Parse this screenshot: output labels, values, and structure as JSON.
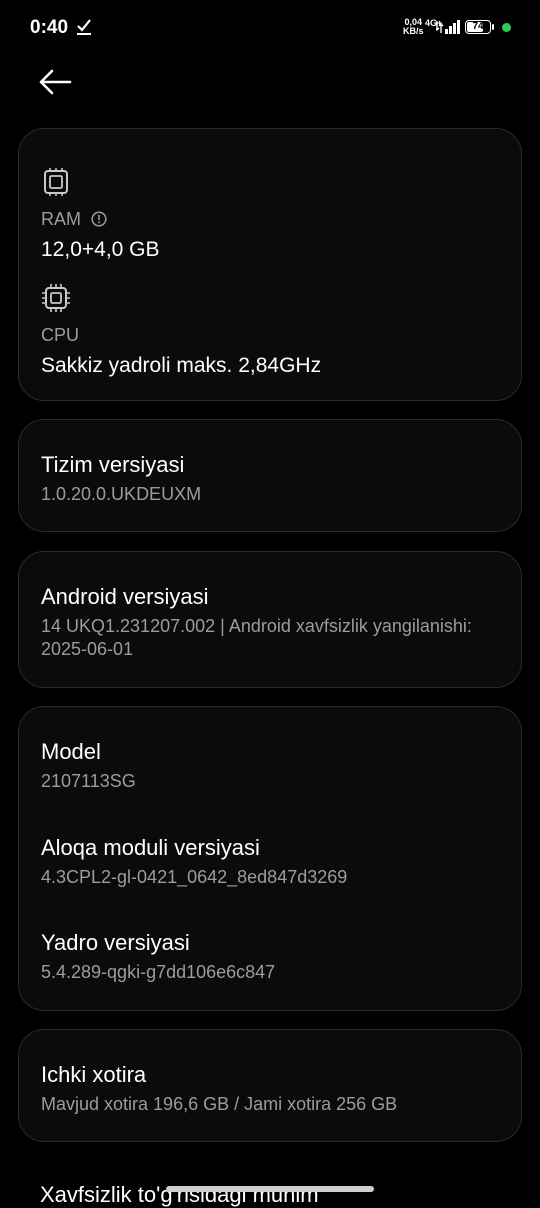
{
  "status_bar": {
    "time": "0:40",
    "net_speed_value": "0,04",
    "net_speed_unit": "KB/s",
    "network_type": "4G+",
    "battery_level": "74",
    "indicator_color": "#2ecc55"
  },
  "hardware": {
    "ram_label": "RAM",
    "ram_value": "12,0+4,0 GB",
    "cpu_label": "CPU",
    "cpu_value": "Sakkiz yadroli maks. 2,84GHz"
  },
  "system_version": {
    "title": "Tizim versiyasi",
    "value": "1.0.20.0.UKDEUXM"
  },
  "android_version": {
    "title": "Android versiyasi",
    "value": "14 UKQ1.231207.002 | Android xavfsizlik yangilanishi: 2025-06-01"
  },
  "device": {
    "model_title": "Model",
    "model_value": "2107113SG",
    "baseband_title": "Aloqa moduli versiyasi",
    "baseband_value": "4.3CPL2-gl-0421_0642_8ed847d3269",
    "kernel_title": "Yadro versiyasi",
    "kernel_value": "5.4.289-qgki-g7dd106e6c847"
  },
  "storage": {
    "title": "Ichki xotira",
    "value": "Mavjud xotira  196,6 GB / Jami xotira  256 GB"
  },
  "footer": {
    "partial_title": "Xavfsizlik to'g'risidagi muhim"
  }
}
